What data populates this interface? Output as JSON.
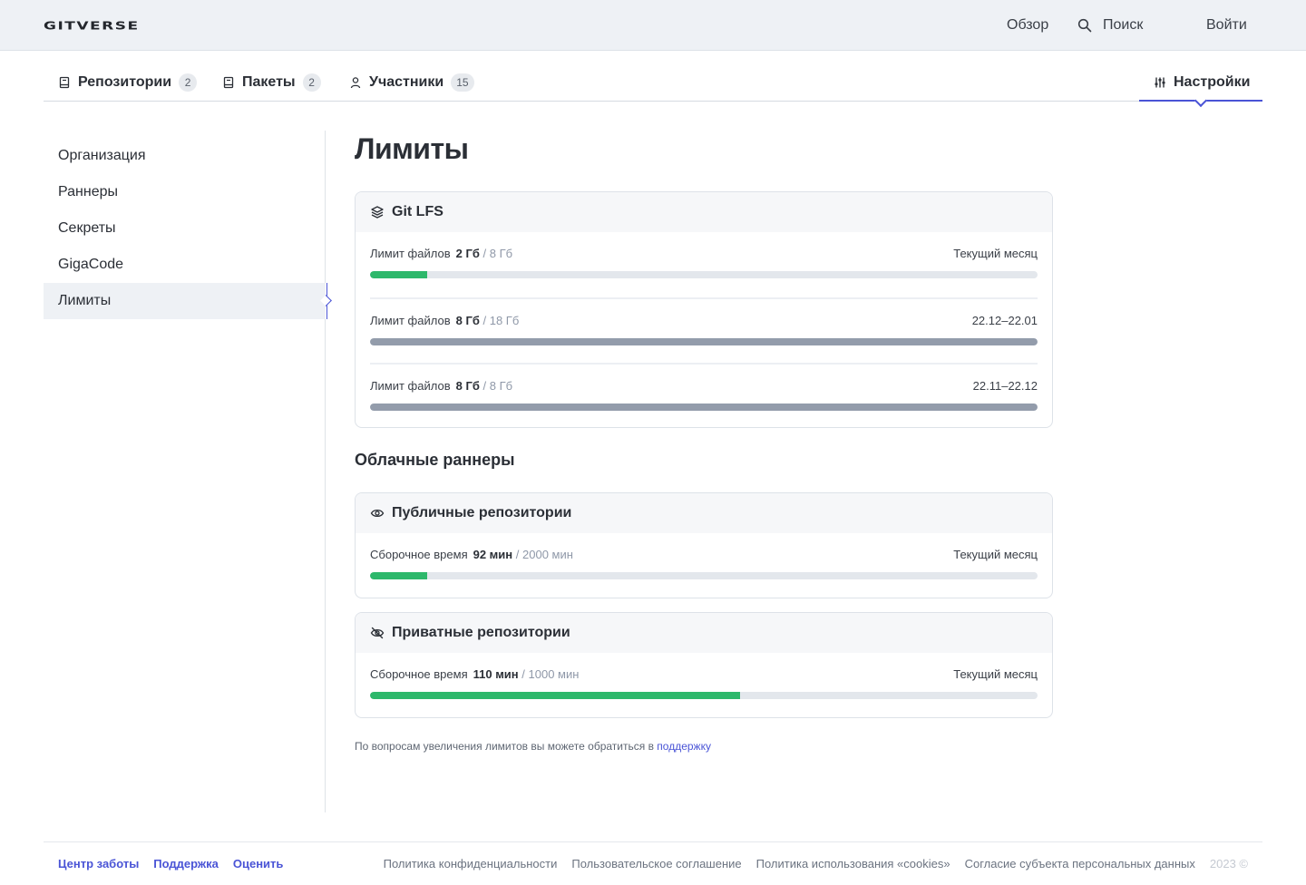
{
  "header": {
    "logo": "GITVERSE",
    "nav_overview": "Обзор",
    "nav_search": "Поиск",
    "nav_login": "Войти"
  },
  "tabs": [
    {
      "label": "Репозитории",
      "count": "2",
      "icon": "repo-icon"
    },
    {
      "label": "Пакеты",
      "count": "2",
      "icon": "package-icon"
    },
    {
      "label": "Участники",
      "count": "15",
      "icon": "user-icon"
    },
    {
      "label": "Настройки",
      "icon": "sliders-icon",
      "active": true
    }
  ],
  "sidebar": {
    "items": [
      {
        "label": "Организация"
      },
      {
        "label": "Раннеры"
      },
      {
        "label": "Секреты"
      },
      {
        "label": "GigaCode"
      },
      {
        "label": "Лимиты",
        "active": true
      }
    ]
  },
  "main": {
    "title": "Лимиты",
    "git_lfs": {
      "title": "Git LFS",
      "icon": "layers-icon",
      "rows": [
        {
          "label": "Лимит файлов",
          "used": "2 Гб",
          "total": "/ 8 Гб",
          "period": "Текущий месяц",
          "fraction": 0.086,
          "color": "#2db86b"
        },
        {
          "label": "Лимит файлов",
          "used": "8 Гб",
          "total": "/ 18 Гб",
          "period": "22.12–22.01",
          "fraction": 1.0,
          "color": "#939cab"
        },
        {
          "label": "Лимит файлов",
          "used": "8 Гб",
          "total": "/ 8 Гб",
          "period": "22.11–22.12",
          "fraction": 1.0,
          "color": "#939cab"
        }
      ]
    },
    "cloud_runners_title": "Облачные раннеры",
    "public_repos": {
      "title": "Публичные репозитории",
      "icon": "eye-icon",
      "row": {
        "label": "Сборочное время",
        "used": "92 мин",
        "total": "/ 2000 мин",
        "period": "Текущий месяц",
        "fraction": 0.086,
        "color": "#2db86b"
      }
    },
    "private_repos": {
      "title": "Приватные репозитории",
      "icon": "eye-off-icon",
      "row": {
        "label": "Сборочное время",
        "used": "110 мин",
        "total": "/ 1000 мин",
        "period": "Текущий месяц",
        "fraction": 0.555,
        "color": "#2db86b"
      }
    },
    "footnote_text": "По вопросам увеличения лимитов вы можете обратиться в ",
    "footnote_link": "поддержку"
  },
  "footer": {
    "left": [
      "Центр заботы",
      "Поддержка",
      "Оценить"
    ],
    "right": [
      "Политика конфиденциальности",
      "Пользовательское соглашение",
      "Политика использования «cookies»",
      "Согласие субъекта персональных данных"
    ],
    "copyright": "2023 ©"
  },
  "colors": {
    "accent": "#4a54d6",
    "progress_green": "#2db86b",
    "progress_gray": "#939cab"
  }
}
